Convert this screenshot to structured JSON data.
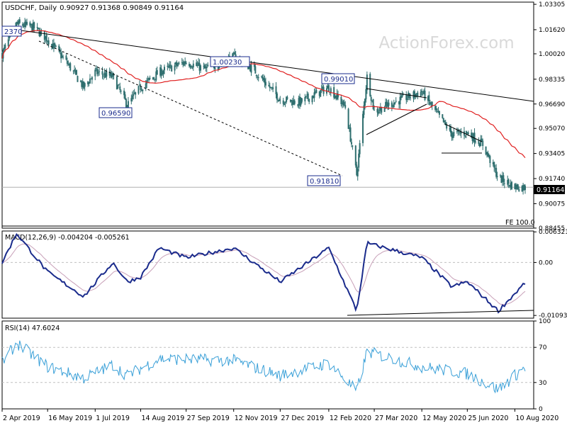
{
  "header": {
    "symbol": "USDCHF",
    "timeframe": "Daily",
    "ohlc": "0.90927 0.91368 0.90849 0.91164"
  },
  "watermark": "ActionForex.com",
  "price_panel": {
    "y_ticks": [
      "1.03305",
      "1.01620",
      "1.00020",
      "0.98335",
      "0.96690",
      "0.95070",
      "0.93405",
      "0.91740",
      "0.90075",
      "0.88455"
    ],
    "last_price": "0.91164",
    "fe_label": "FE 100.0",
    "annotations": [
      "2370",
      "1.00230",
      "0.96590",
      "0.99010",
      "0.91810"
    ]
  },
  "macd_panel": {
    "label": "MACD(12,26,9) -0.004204 -0.005261",
    "y_ticks": [
      "0.006321",
      "0.00",
      "-0.010939"
    ]
  },
  "rsi_panel": {
    "label": "RSI(14) 47.6024",
    "y_ticks": [
      "100",
      "70",
      "30",
      "0"
    ]
  },
  "x_ticks": [
    "2 Apr 2019",
    "16 May 2019",
    "1 Jul 2019",
    "14 Aug 2019",
    "27 Sep 2019",
    "12 Nov 2019",
    "27 Dec 2019",
    "12 Feb 2020",
    "27 Mar 2020",
    "12 May 2020",
    "25 Jun 2020",
    "10 Aug 2020"
  ],
  "colors": {
    "candle": "#2f6f6f",
    "ma": "#e02020",
    "macd": "#1a2b8c",
    "signal": "#c8a0b8",
    "rsi": "#3aa0d8",
    "trendline": "#000000",
    "grid": "#c0c0c0"
  },
  "chart_data": [
    {
      "type": "candlestick",
      "title": "USDCHF, Daily",
      "indicators": [
        "moving average (red)"
      ],
      "ylim": [
        0.8845,
        1.0345
      ],
      "anchors": [
        {
          "date": "2 Apr 2019",
          "close": 1.0
        },
        {
          "date": "16 Apr 2019",
          "close": 1.02
        },
        {
          "date": "2 May 2019",
          "close": 1.018
        },
        {
          "date": "16 May 2019",
          "close": 1.01
        },
        {
          "date": "5 Jun 2019",
          "close": 0.993
        },
        {
          "date": "20 Jun 2019",
          "close": 0.978
        },
        {
          "date": "1 Jul 2019",
          "close": 0.988
        },
        {
          "date": "18 Jul 2019",
          "close": 0.985
        },
        {
          "date": "1 Aug 2019",
          "close": 0.966
        },
        {
          "date": "14 Aug 2019",
          "close": 0.978
        },
        {
          "date": "1 Sep 2019",
          "close": 0.988
        },
        {
          "date": "27 Sep 2019",
          "close": 0.995
        },
        {
          "date": "15 Oct 2019",
          "close": 0.99
        },
        {
          "date": "12 Nov 2019",
          "close": 0.998
        },
        {
          "date": "1 Dec 2019",
          "close": 0.99
        },
        {
          "date": "27 Dec 2019",
          "close": 0.97
        },
        {
          "date": "15 Jan 2020",
          "close": 0.968
        },
        {
          "date": "12 Feb 2020",
          "close": 0.978
        },
        {
          "date": "28 Feb 2020",
          "close": 0.965
        },
        {
          "date": "10 Mar 2020",
          "close": 0.92
        },
        {
          "date": "20 Mar 2020",
          "close": 0.985
        },
        {
          "date": "27 Mar 2020",
          "close": 0.962
        },
        {
          "date": "15 Apr 2020",
          "close": 0.968
        },
        {
          "date": "12 May 2020",
          "close": 0.975
        },
        {
          "date": "25 May 2020",
          "close": 0.962
        },
        {
          "date": "10 Jun 2020",
          "close": 0.947
        },
        {
          "date": "25 Jun 2020",
          "close": 0.948
        },
        {
          "date": "10 Jul 2020",
          "close": 0.94
        },
        {
          "date": "25 Jul 2020",
          "close": 0.918
        },
        {
          "date": "10 Aug 2020",
          "close": 0.912
        },
        {
          "date": "20 Aug 2020",
          "close": 0.9116
        }
      ]
    },
    {
      "type": "line",
      "title": "MACD(12,26,9)",
      "series": [
        {
          "name": "MACD",
          "anchors": [
            {
              "date": "2 Apr 2019",
              "value": 0.0
            },
            {
              "date": "16 Apr 2019",
              "value": 0.006
            },
            {
              "date": "16 May 2019",
              "value": -0.002
            },
            {
              "date": "20 Jun 2019",
              "value": -0.007
            },
            {
              "date": "18 Jul 2019",
              "value": 0.0
            },
            {
              "date": "1 Aug 2019",
              "value": -0.004
            },
            {
              "date": "14 Aug 2019",
              "value": -0.003
            },
            {
              "date": "1 Sep 2019",
              "value": 0.003
            },
            {
              "date": "27 Sep 2019",
              "value": 0.001
            },
            {
              "date": "12 Nov 2019",
              "value": 0.003
            },
            {
              "date": "27 Dec 2019",
              "value": -0.004
            },
            {
              "date": "12 Feb 2020",
              "value": 0.003
            },
            {
              "date": "10 Mar 2020",
              "value": -0.01
            },
            {
              "date": "20 Mar 2020",
              "value": 0.004
            },
            {
              "date": "12 May 2020",
              "value": 0.001
            },
            {
              "date": "10 Jun 2020",
              "value": -0.005
            },
            {
              "date": "25 Jun 2020",
              "value": -0.004
            },
            {
              "date": "25 Jul 2020",
              "value": -0.01
            },
            {
              "date": "20 Aug 2020",
              "value": -0.0042
            }
          ]
        }
      ],
      "ylim": [
        -0.0115,
        0.0065
      ]
    },
    {
      "type": "line",
      "title": "RSI(14)",
      "series": [
        {
          "name": "RSI",
          "anchors": [
            {
              "date": "2 Apr 2019",
              "value": 52
            },
            {
              "date": "16 Apr 2019",
              "value": 75
            },
            {
              "date": "16 May 2019",
              "value": 48
            },
            {
              "date": "20 Jun 2019",
              "value": 35
            },
            {
              "date": "18 Jul 2019",
              "value": 50
            },
            {
              "date": "1 Aug 2019",
              "value": 38
            },
            {
              "date": "1 Sep 2019",
              "value": 57
            },
            {
              "date": "12 Nov 2019",
              "value": 55
            },
            {
              "date": "27 Dec 2019",
              "value": 38
            },
            {
              "date": "12 Feb 2020",
              "value": 52
            },
            {
              "date": "10 Mar 2020",
              "value": 20
            },
            {
              "date": "20 Mar 2020",
              "value": 65
            },
            {
              "date": "12 May 2020",
              "value": 48
            },
            {
              "date": "25 Jun 2020",
              "value": 40
            },
            {
              "date": "25 Jul 2020",
              "value": 22
            },
            {
              "date": "20 Aug 2020",
              "value": 47.6
            }
          ]
        }
      ],
      "ylim": [
        0,
        100
      ]
    }
  ]
}
